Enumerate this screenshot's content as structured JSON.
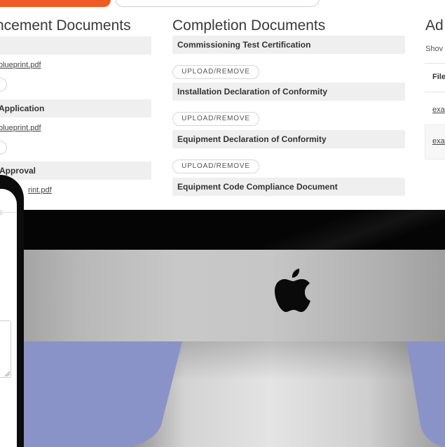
{
  "columns": {
    "commencement": {
      "title": "ncement Documents",
      "items": [
        {
          "label": "",
          "file": "blueprint.pdf"
        },
        {
          "label": "Application",
          "file": "blueprint.pdf"
        },
        {
          "label": "Approval",
          "file": "rint.pdf"
        }
      ]
    },
    "completion": {
      "title": "Completion Documents",
      "items": [
        "Commissioning Test Certification",
        "Installation Declaration of Conformity",
        "Equipment Declaration of Conformity",
        "Equipment Code Compliance Document"
      ],
      "upload_label": "UPLOAD/REMOVE"
    },
    "additional": {
      "title": "Ad",
      "show_text": "Shov",
      "table_header": "File",
      "rows": [
        "exa",
        "exa"
      ]
    }
  },
  "colors": {
    "accent": "#f15a22",
    "bar_bg": "#efefef",
    "wall": "#8a93c7"
  },
  "icons": {
    "logo": "apple-logo",
    "resize": "resize-handle-icon"
  }
}
